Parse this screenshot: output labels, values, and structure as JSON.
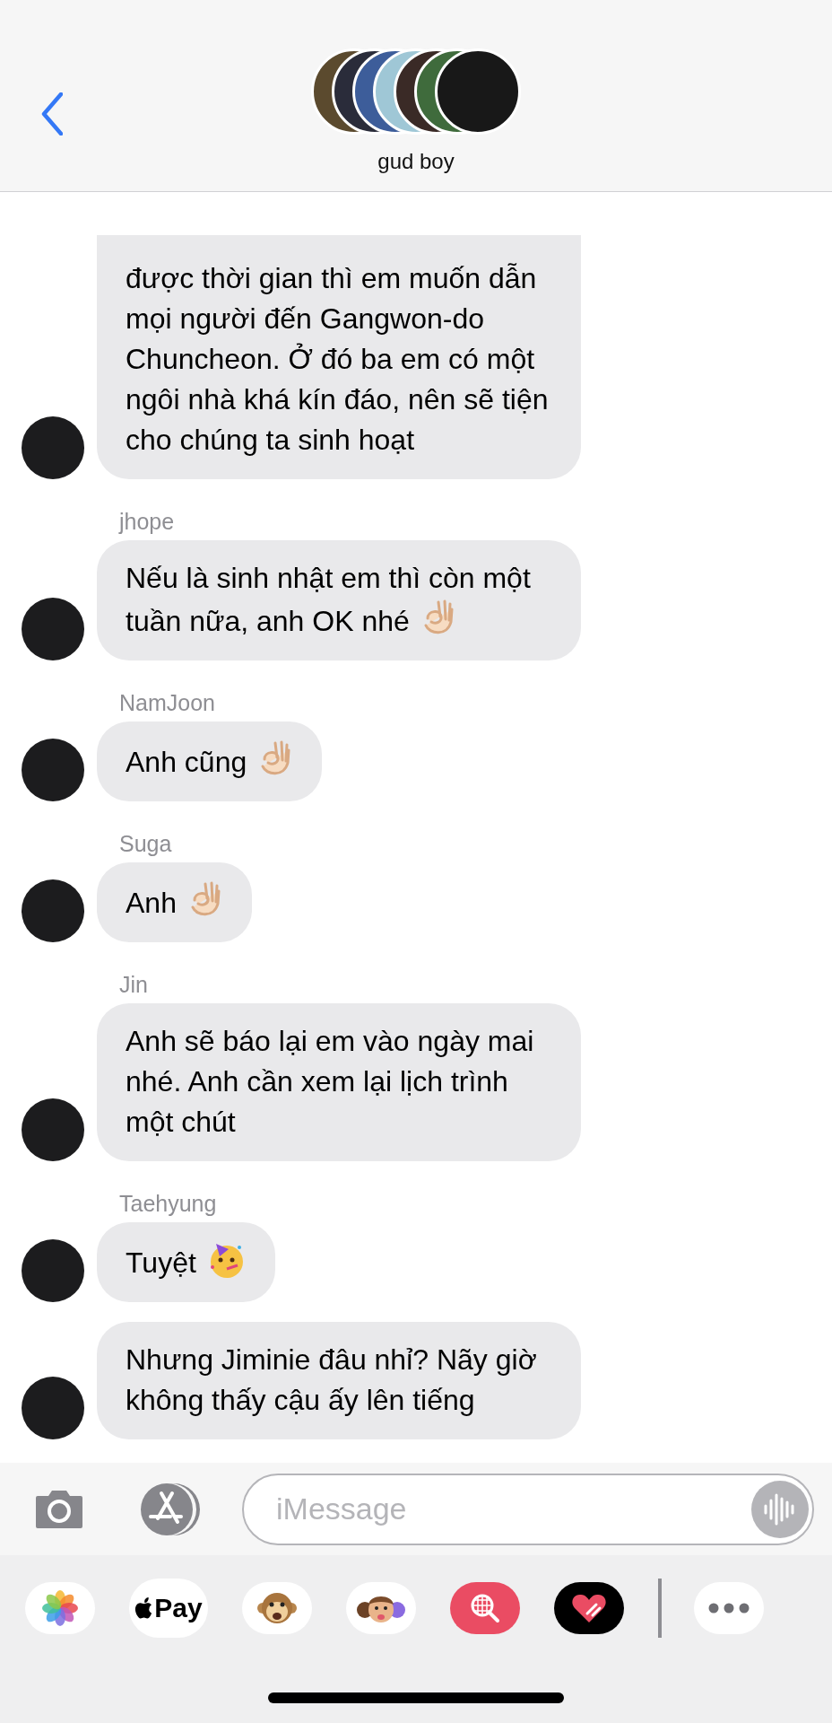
{
  "header": {
    "title": "gud boy"
  },
  "messages": [
    {
      "text": "được thời gian thì em muốn dẫn mọi người đến Gangwon-do Chuncheon. Ở đó ba em có một ngôi nhà khá kín đáo, nên sẽ tiện cho chúng ta sinh hoạt",
      "kind": "plain",
      "cut_top": true
    },
    {
      "sender": "jhope",
      "text": "Nếu là sinh nhật em thì còn một tuần nữa, anh OK nhé",
      "kind": "ok-hand",
      "cut_top": false
    },
    {
      "sender": "NamJoon",
      "text": "Anh cũng",
      "kind": "ok-hand",
      "cut_top": false
    },
    {
      "sender": "Suga",
      "text": "Anh",
      "kind": "ok-hand",
      "cut_top": false
    },
    {
      "sender": "Jin",
      "text": "Anh sẽ báo lại em vào ngày mai nhé. Anh cần xem lại lịch trình một chút",
      "kind": "plain",
      "cut_top": false
    },
    {
      "sender": "Taehyung",
      "text": "Tuyệt",
      "kind": "party",
      "cut_top": false
    },
    {
      "text": "Nhưng Jiminie đâu nhỉ? Nãy giờ không thấy cậu ấy lên tiếng",
      "kind": "plain",
      "cut_top": false
    }
  ],
  "composer": {
    "placeholder": "iMessage"
  },
  "apps": [
    {
      "kind": "photos"
    },
    {
      "kind": "pay",
      "label": "Pay"
    },
    {
      "kind": "monkey"
    },
    {
      "kind": "memoji"
    },
    {
      "kind": "search"
    },
    {
      "kind": "heart"
    },
    {
      "kind": "divider"
    },
    {
      "kind": "more"
    }
  ]
}
